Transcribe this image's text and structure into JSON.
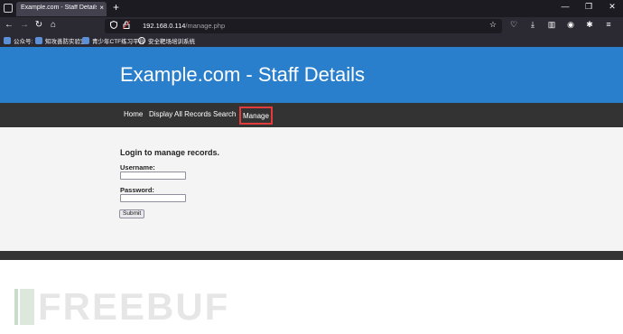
{
  "browser": {
    "tab_title": "Example.com - Staff Details - We",
    "tab_close": "×",
    "new_tab": "+",
    "window_controls": [
      "—",
      "❐",
      "✕"
    ],
    "nav": {
      "back": "←",
      "forward": "→",
      "reload": "↻",
      "home": "⌂"
    },
    "url_host": "192.168.0.114",
    "url_path": "/manage.php",
    "bookmarks": [
      "公众号:",
      "知攻善防实验室",
      "青少年CTF练习平台",
      "安全靶场培训系统"
    ]
  },
  "site": {
    "title": "Example.com - Staff Details",
    "nav": [
      "Home",
      "Display All Records",
      "Search",
      "Manage"
    ]
  },
  "login": {
    "heading": "Login to manage records.",
    "username_label": "Username:",
    "password_label": "Password:",
    "submit_label": "Submit"
  },
  "watermark": "FREEBUF",
  "colors": {
    "header_blue": "#2a7fcd",
    "nav_dark": "#333333",
    "active_outline": "#e23b3b",
    "content_bg": "#f4f4f4"
  }
}
